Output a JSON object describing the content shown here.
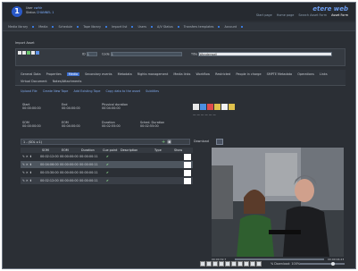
{
  "header": {
    "user_label": "User",
    "user_value": "cwfdr",
    "status_label": "Status",
    "status_value": "CHANNEL 1",
    "brand": "etere web",
    "links": [
      "Start page",
      "Home page",
      "Search Asset Form",
      "Asset Form"
    ]
  },
  "menubar": {
    "items": [
      "Media library",
      "Media",
      "Schedule",
      "Tape library",
      "Import list",
      "Users",
      "A/V Status",
      "Transfers templates",
      "Account"
    ]
  },
  "asset": {
    "section_title": "Import Asset",
    "id_label": "ID",
    "id_value": "1",
    "code_label": "Code",
    "code_value": "1",
    "title_label": "Title",
    "title_value": "Wonderwall"
  },
  "tabs": {
    "items": [
      "General Data",
      "Properties",
      "Media",
      "Secondary events",
      "Metadata",
      "Rights management",
      "Media links",
      "Workflow",
      "Restricted",
      "People in charge",
      "SMPTE Metadata",
      "Operations",
      "Links",
      "Virtual Document",
      "Notes/Attachments"
    ],
    "active_index": 2
  },
  "subtabs": [
    "Upload File",
    "Create New Tape",
    "Add Existing Tape",
    "Copy data to the asset",
    "Subtitles"
  ],
  "times": {
    "start_label": "Start",
    "start_value": "00:00:00:00",
    "end_label": "End",
    "end_value": "00:04:00:00",
    "physical_label": "Physical duration",
    "physical_value": "00:04:00:00",
    "som_label": "SOM",
    "som_value": "00:00:00:00",
    "eom_label": "EOM",
    "eom_value": "00:04:00:00",
    "duration_label": "Duration",
    "duration_value": "00:02:55:00",
    "sched_label": "Sched. Duration",
    "sched_value": "00:02:55:00"
  },
  "segments": {
    "bar_label": "1 - (SOL v.1)",
    "columns": [
      "SOM",
      "EOM",
      "Duration",
      "Cue point",
      "Description",
      "Type",
      "Show"
    ],
    "rows": [
      {
        "som": "00:02:12:00",
        "eom": "00:00:00:00",
        "duration": "00:00:00:11",
        "check": "✔"
      },
      {
        "som": "00:04:06:00",
        "eom": "00:00:00:00",
        "duration": "00:00:00:11",
        "check": "✔"
      },
      {
        "som": "00:03:30:00",
        "eom": "00:00:00:00",
        "duration": "00:00:00:11",
        "check": "✔"
      },
      {
        "som": "00:02:12:00",
        "eom": "00:00:00:00",
        "duration": "00:00:00:11",
        "check": "✔"
      }
    ]
  },
  "player": {
    "download_label": "Download",
    "current_time": "00:00:32.7",
    "total_time": "00:00:04.23",
    "download_pct": "% Download: 100%"
  },
  "icons": [
    "panel-icon",
    "folder-icon",
    "play-icon",
    "bookmark-icon",
    "camera-icon",
    "tape-icon"
  ],
  "colors": {
    "accent": "#3c6fd0",
    "brand": "#6c9df0"
  }
}
